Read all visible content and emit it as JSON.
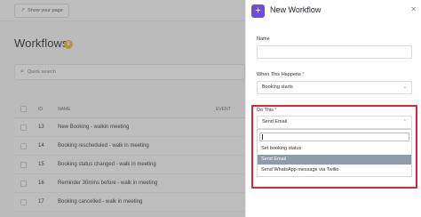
{
  "topbar": {
    "share_label": "Show your page"
  },
  "page": {
    "title": "Workflows",
    "count": "9"
  },
  "search": {
    "placeholder": "Quick search"
  },
  "table": {
    "headers": {
      "id": "ID",
      "name": "NAME",
      "event": "EVENT"
    },
    "rows": [
      {
        "id": "13",
        "name": "New Booking - walkin meeting"
      },
      {
        "id": "14",
        "name": "Booking rescheduled - walk in meeting"
      },
      {
        "id": "15",
        "name": "Booking status changed - walk in meeting"
      },
      {
        "id": "16",
        "name": "Reminder 30mins before - walk in meeting"
      },
      {
        "id": "17",
        "name": "Booking cancelled - walk in meeting"
      }
    ]
  },
  "drawer": {
    "title": "New Workflow",
    "name_label": "Name",
    "when_label": "When This Happens",
    "when_value": "Booking starts",
    "do_label": "Do This",
    "do_value": "Send Email",
    "required_mark": "*",
    "options": [
      "Set booking status",
      "Send Email",
      "Send WhatsApp message via Twilio"
    ]
  },
  "colors": {
    "accent": "#6f4ed8",
    "highlight": "#d7263d",
    "selected_option": "#8e9baa",
    "badge": "#f3b33c"
  }
}
